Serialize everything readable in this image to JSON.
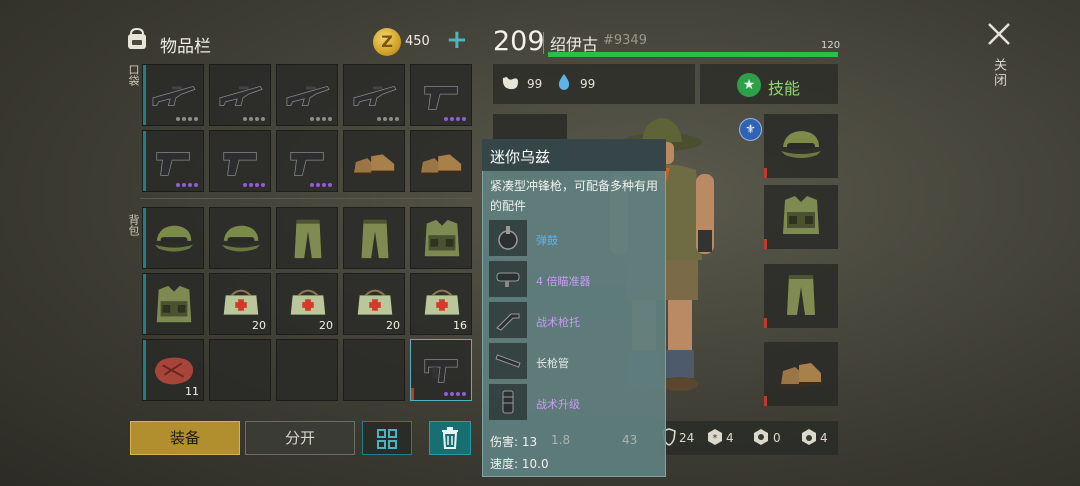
{
  "inventory": {
    "title": "物品栏",
    "coins": "450",
    "plus": "+",
    "pocket_label": "口袋",
    "backpack_label": "背包",
    "pocket_slots": [
      {
        "item": "assault-rifle",
        "dots": "gray4"
      },
      {
        "item": "assault-rifle",
        "dots": "gray4"
      },
      {
        "item": "assault-rifle",
        "dots": "gray4"
      },
      {
        "item": "assault-rifle",
        "dots": "gray4"
      },
      {
        "item": "pistol",
        "dots": "purple4"
      },
      {
        "item": "pistol",
        "dots": "purple4"
      },
      {
        "item": "pistol",
        "dots": "purple4"
      },
      {
        "item": "pistol",
        "dots": "purple4"
      },
      {
        "item": "boots",
        "dots": ""
      },
      {
        "item": "boots",
        "dots": ""
      }
    ],
    "backpack_slots": [
      {
        "item": "camo-cap",
        "count": ""
      },
      {
        "item": "camo-cap",
        "count": ""
      },
      {
        "item": "camo-pants",
        "count": ""
      },
      {
        "item": "camo-pants",
        "count": ""
      },
      {
        "item": "camo-vest",
        "count": ""
      },
      {
        "item": "camo-vest",
        "count": ""
      },
      {
        "item": "medkit",
        "count": "20"
      },
      {
        "item": "medkit",
        "count": "20"
      },
      {
        "item": "medkit",
        "count": "20"
      },
      {
        "item": "medkit",
        "count": "16"
      },
      {
        "item": "meat",
        "count": "11"
      },
      {
        "item": "empty",
        "count": ""
      },
      {
        "item": "empty",
        "count": ""
      },
      {
        "item": "empty",
        "count": ""
      },
      {
        "item": "mini-uzi",
        "count": ""
      }
    ]
  },
  "buttons": {
    "equip": "装备",
    "split": "分开"
  },
  "player": {
    "level": "209",
    "name": "绍伊古",
    "id": "#9349",
    "hp": "120",
    "food": "99",
    "water": "99",
    "skills": "技能"
  },
  "stats_row": {
    "a": "24",
    "b": "4",
    "c": "0",
    "d": "4"
  },
  "tooltip": {
    "title": "迷你乌兹",
    "description": "紧凑型冲锋枪，可配备多种有用的配件",
    "attachments": [
      {
        "name": "弹鼓",
        "color": "blue"
      },
      {
        "name": "4 倍瞄准器",
        "color": "purple"
      },
      {
        "name": "战术枪托",
        "color": "purple"
      },
      {
        "name": "长枪管",
        "color": "white"
      },
      {
        "name": "战术升级",
        "color": "purple"
      }
    ],
    "damage": "伤害: 13",
    "speed": "速度: 10.0",
    "hidden_values": [
      "1.8",
      "43"
    ]
  },
  "close": {
    "label": "关闭"
  },
  "colors": {
    "accent_teal": "#4fb3bd",
    "hp_green": "#2bbf4a",
    "equip_gold": "#b28f2e",
    "rarity_purple": "#8e5fd6"
  }
}
